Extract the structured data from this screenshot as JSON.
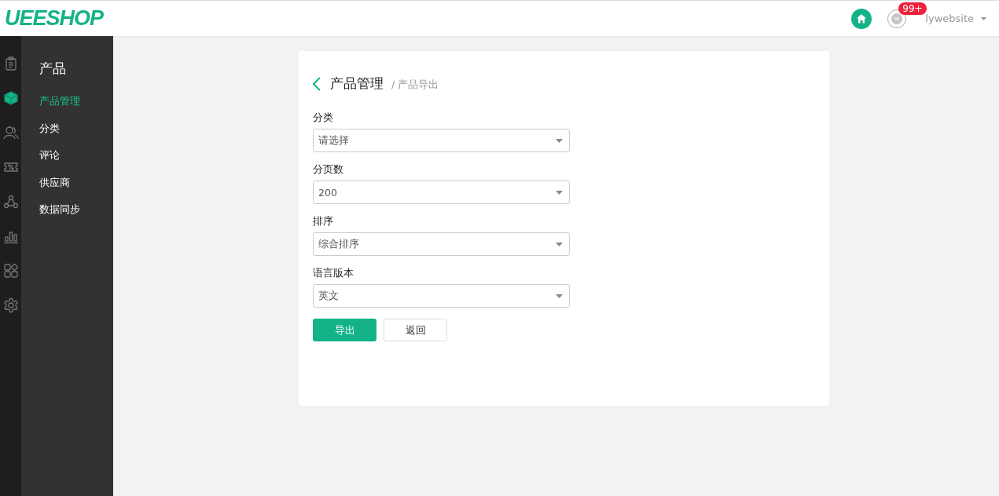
{
  "header": {
    "logo": "UEESHOP",
    "message_badge": "99+",
    "user": "lywebsite"
  },
  "rail": [
    {
      "kind": "clipboard",
      "selected": false
    },
    {
      "kind": "cube",
      "selected": true
    },
    {
      "kind": "users",
      "selected": false
    },
    {
      "kind": "coupon",
      "selected": false
    },
    {
      "kind": "network",
      "selected": false
    },
    {
      "kind": "chart",
      "selected": false
    },
    {
      "kind": "apps",
      "selected": false
    },
    {
      "kind": "gear",
      "selected": false
    }
  ],
  "sidebar": {
    "title": "产品",
    "items": [
      {
        "label": "产品管理",
        "selected": true
      },
      {
        "label": "分类",
        "selected": false
      },
      {
        "label": "评论",
        "selected": false
      },
      {
        "label": "供应商",
        "selected": false
      },
      {
        "label": "数据同步",
        "selected": false
      }
    ]
  },
  "page": {
    "title": "产品管理",
    "breadcrumb": "/ 产品导出"
  },
  "fields": [
    {
      "label": "分类",
      "value": "请选择"
    },
    {
      "label": "分页数",
      "value": "200"
    },
    {
      "label": "排序",
      "value": "综合排序"
    },
    {
      "label": "语言版本",
      "value": "英文"
    }
  ],
  "buttons": [
    {
      "label": "导出",
      "kind": "primary"
    },
    {
      "label": "返回",
      "kind": "secondary"
    }
  ]
}
